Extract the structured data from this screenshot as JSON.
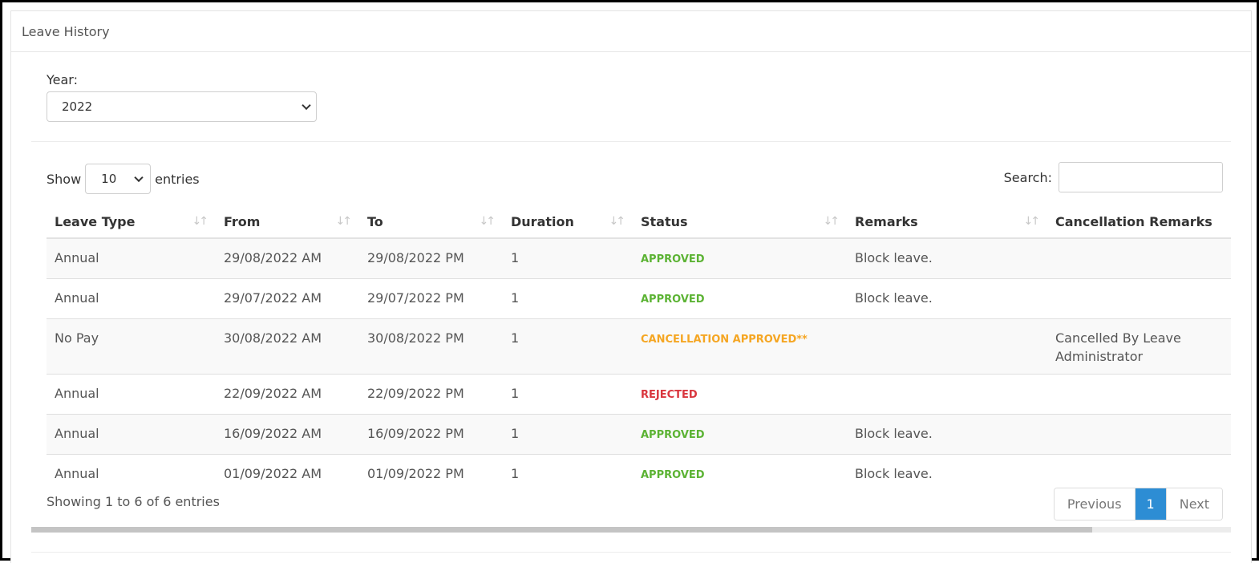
{
  "panel": {
    "title": "Leave History"
  },
  "year_filter": {
    "label": "Year:",
    "selected": "2022"
  },
  "length": {
    "show_label": "Show",
    "selected": "10",
    "entries_label": "entries"
  },
  "search": {
    "label": "Search:",
    "value": ""
  },
  "table": {
    "columns": [
      "Leave Type",
      "From",
      "To",
      "Duration",
      "Status",
      "Remarks",
      "Cancellation Remarks"
    ],
    "rows": [
      {
        "leave_type": "Annual",
        "from": "29/08/2022 AM",
        "to": "29/08/2022 PM",
        "duration": "1",
        "status": "APPROVED",
        "status_kind": "approved",
        "remarks": "Block leave.",
        "cancellation_remarks": ""
      },
      {
        "leave_type": "Annual",
        "from": "29/07/2022 AM",
        "to": "29/07/2022 PM",
        "duration": "1",
        "status": "APPROVED",
        "status_kind": "approved",
        "remarks": "Block leave.",
        "cancellation_remarks": ""
      },
      {
        "leave_type": "No Pay",
        "from": "30/08/2022 AM",
        "to": "30/08/2022 PM",
        "duration": "1",
        "status": "CANCELLATION APPROVED**",
        "status_kind": "cancel",
        "remarks": "",
        "cancellation_remarks": "Cancelled By Leave Administrator"
      },
      {
        "leave_type": "Annual",
        "from": "22/09/2022 AM",
        "to": "22/09/2022 PM",
        "duration": "1",
        "status": "REJECTED",
        "status_kind": "rejected",
        "remarks": "",
        "cancellation_remarks": ""
      },
      {
        "leave_type": "Annual",
        "from": "16/09/2022 AM",
        "to": "16/09/2022 PM",
        "duration": "1",
        "status": "APPROVED",
        "status_kind": "approved",
        "remarks": "Block leave.",
        "cancellation_remarks": ""
      },
      {
        "leave_type": "Annual",
        "from": "01/09/2022 AM",
        "to": "01/09/2022 PM",
        "duration": "1",
        "status": "APPROVED",
        "status_kind": "approved",
        "remarks": "Block leave.",
        "cancellation_remarks": ""
      }
    ]
  },
  "info": "Showing 1 to 6 of 6 entries",
  "pagination": {
    "previous": "Previous",
    "current": "1",
    "next": "Next"
  },
  "colors": {
    "approved": "#5cb334",
    "cancellation_approved": "#f5a623",
    "rejected": "#d9363e",
    "active_page": "#2d8dd4"
  },
  "scrollbar": {
    "position_fraction": 0.0,
    "visible_fraction": 0.88
  }
}
